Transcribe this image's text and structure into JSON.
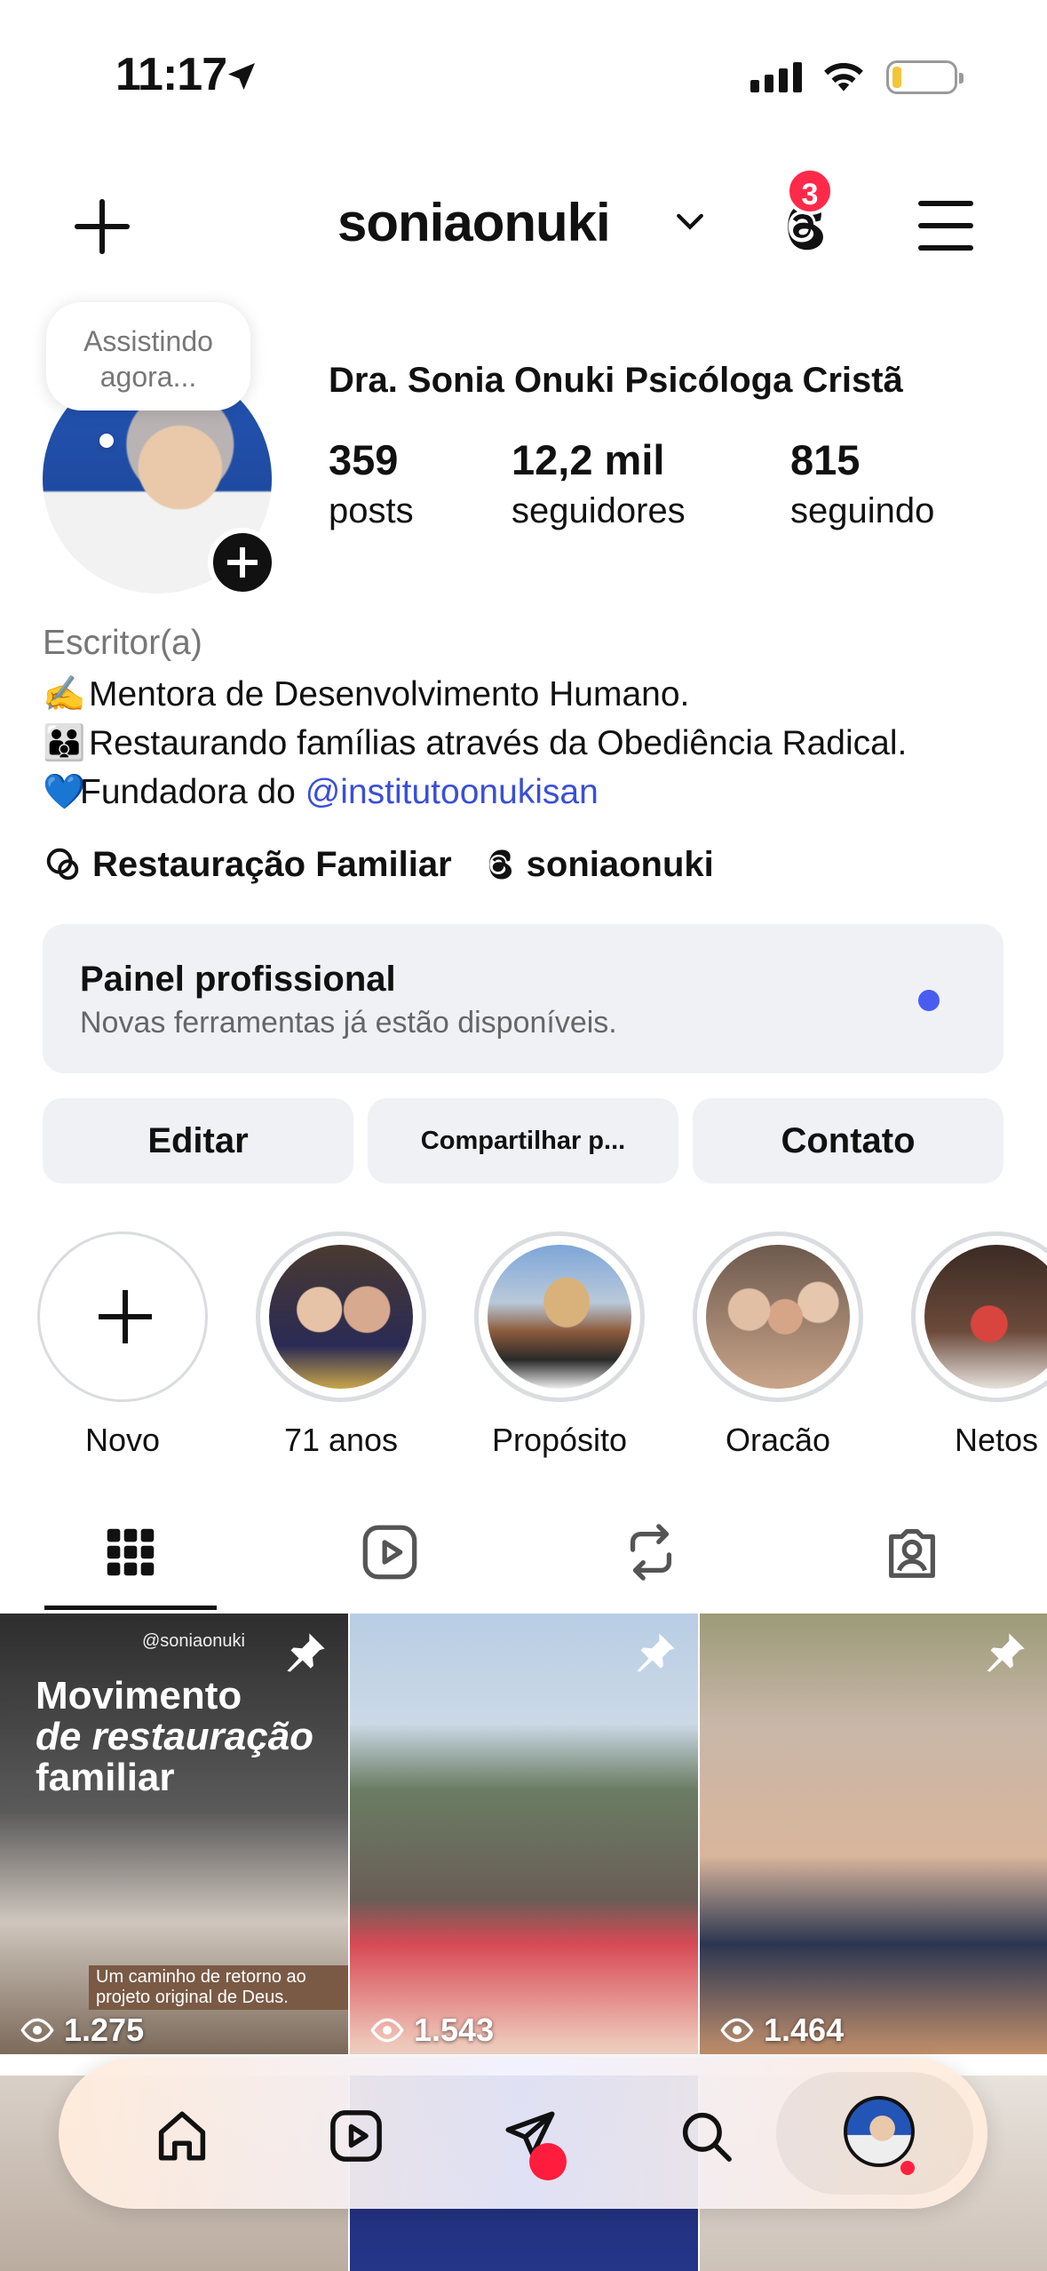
{
  "status_bar": {
    "time": "11:17"
  },
  "header": {
    "username": "soniaonuki",
    "threads_badge": "3"
  },
  "profile": {
    "note": "Assistindo agora...",
    "display_name": "Dra. Sonia Onuki Psicóloga Cristã",
    "stats": [
      {
        "value": "359",
        "label": "posts"
      },
      {
        "value": "12,2 mil",
        "label": "seguidores"
      },
      {
        "value": "815",
        "label": "seguindo"
      }
    ],
    "category": "Escritor(a)",
    "bio": {
      "line1_emoji": "✍️",
      "line1": "Mentora de Desenvolvimento Humano.",
      "line2_emoji": "👪",
      "line2": "Restaurando famílias através da Obediência Radical.",
      "line3_emoji": "💙",
      "line3": "Fundadora do ",
      "line3_mention": "@institutoonukisan"
    },
    "links": [
      {
        "icon": "broadcast-channel-icon",
        "label": "Restauração Familiar"
      },
      {
        "icon": "threads-icon",
        "label": "soniaonuki"
      }
    ]
  },
  "dashboard": {
    "title": "Painel profissional",
    "subtitle": "Novas ferramentas já estão disponíveis."
  },
  "buttons": {
    "edit": "Editar",
    "share": "Compartilhar p...",
    "contact": "Contato"
  },
  "highlights": [
    {
      "label": "Novo"
    },
    {
      "label": "71 anos"
    },
    {
      "label": "Propósito"
    },
    {
      "label": "Oracão"
    },
    {
      "label": "Netos"
    }
  ],
  "tabs": [
    "grid-icon",
    "reels-icon",
    "reposts-icon",
    "tagged-icon"
  ],
  "posts": [
    {
      "views": "1.275",
      "pinned": true,
      "overlay_tag": "@soniaonuki",
      "overlay_title_line1": "Movimento",
      "overlay_title_line2": "de restauração",
      "overlay_title_line3": "familiar",
      "overlay_caption": "Um caminho de retorno ao projeto original de Deus."
    },
    {
      "views": "1.543",
      "pinned": true
    },
    {
      "views": "1.464",
      "pinned": true
    }
  ],
  "colors": {
    "accent_blue": "#3a4fd8",
    "badge_red": "#ff2a4a",
    "panel_bg": "#eff1f5"
  }
}
